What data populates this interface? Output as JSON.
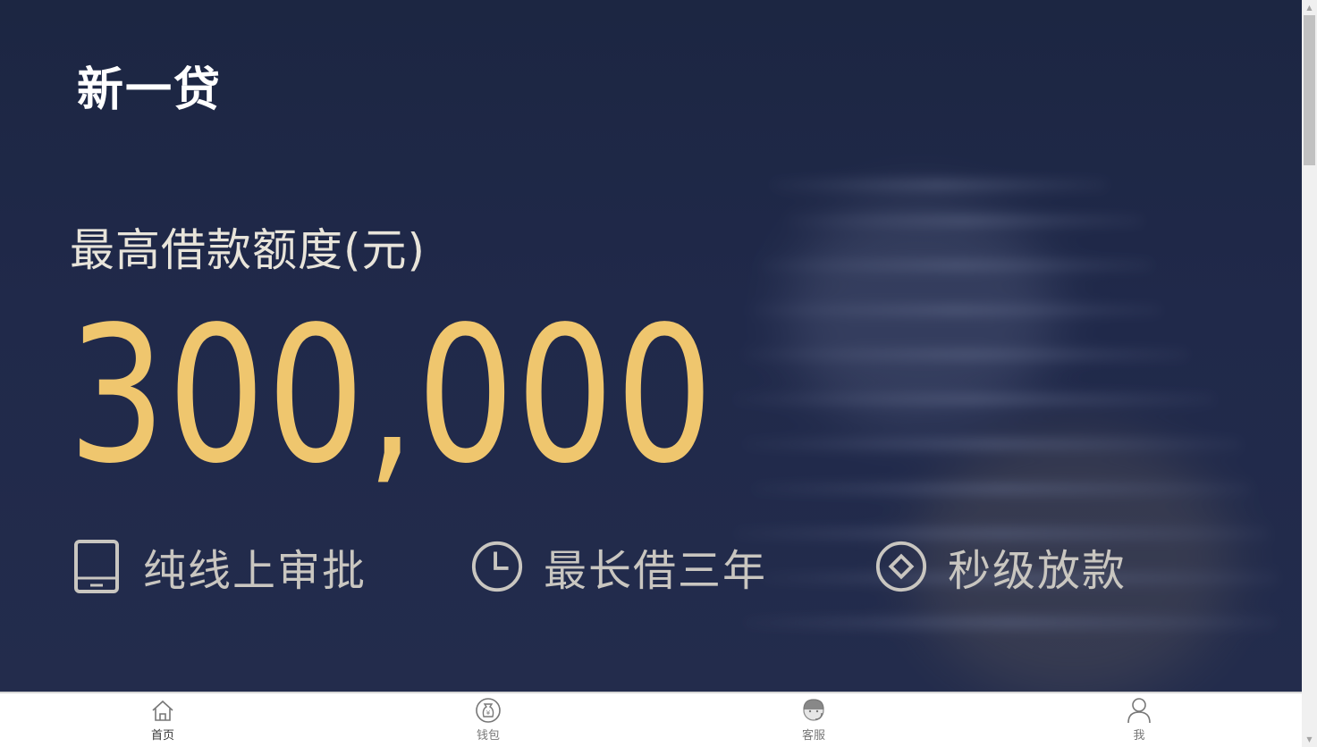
{
  "hero": {
    "brand": "新一贷",
    "subtitle": "最高借款额度(元)",
    "amount": "300,000",
    "features": [
      {
        "icon": "tablet-icon",
        "label": "纯线上审批"
      },
      {
        "icon": "clock-icon",
        "label": "最长借三年"
      },
      {
        "icon": "diamond-icon",
        "label": "秒级放款"
      }
    ],
    "colors": {
      "background": "#1f2947",
      "amount": "#efc66e",
      "feature_text": "#c9c6c0"
    }
  },
  "tabbar": {
    "items": [
      {
        "icon": "home-icon",
        "label": "首页",
        "active": true
      },
      {
        "icon": "money-bag-icon",
        "label": "钱包",
        "active": false
      },
      {
        "icon": "customer-service-icon",
        "label": "客服",
        "active": false
      },
      {
        "icon": "user-icon",
        "label": "我",
        "active": false
      }
    ]
  }
}
